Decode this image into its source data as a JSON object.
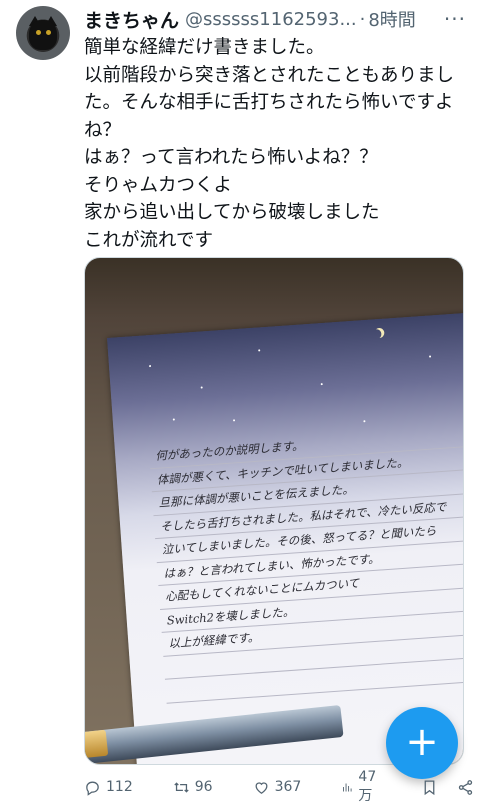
{
  "tweet": {
    "display_name": "まきちゃん",
    "handle": "@ssssss1162593...",
    "separator": "·",
    "time": "8時間",
    "text": "簡単な経緯だけ書きました。\n以前階段から突き落とされたこともありました。そんな相手に舌打ちされたら怖いですよね？\nはぁ？って言われたら怖いよね？？\nそりゃムカつくよ\n家から追い出してから破壊しました\nこれが流れです",
    "media": {
      "letter_lines": [
        "何があったのか説明します。",
        "体調が悪くて、キッチンで吐いてしまいました。",
        "旦那に体調が悪いことを伝えました。",
        "そしたら舌打ちされました。私はそれで、冷たい反応で",
        "泣いてしまいました。その後、怒ってる？と聞いたら",
        "はぁ？と言われてしまい、怖かったです。",
        "心配もしてくれないことにムカついて",
        "Switch2を壊しました。",
        "以上が経緯です。"
      ]
    }
  },
  "actions": {
    "replies": "112",
    "retweets": "96",
    "likes": "367",
    "views": "47万"
  },
  "colors": {
    "accent": "#1d9bf0",
    "muted": "#536471",
    "text": "#0f1419"
  },
  "icons": [
    "more-icon",
    "reply-icon",
    "retweet-icon",
    "like-icon",
    "views-icon",
    "bookmark-icon",
    "share-icon",
    "compose-plus-icon"
  ]
}
